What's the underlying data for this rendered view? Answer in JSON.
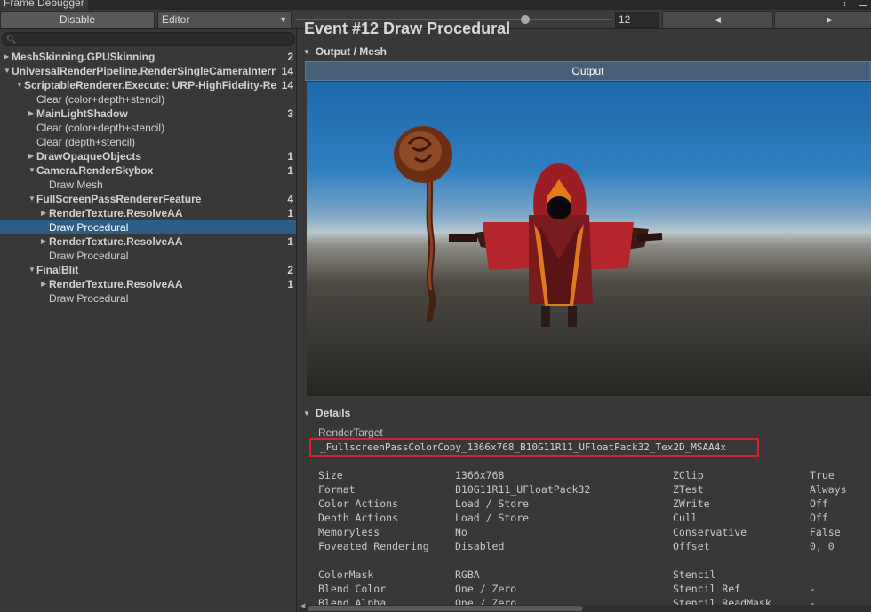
{
  "window": {
    "title": "Frame Debugger"
  },
  "toolbar": {
    "disable_label": "Disable",
    "target_label": "Editor",
    "frame_value": "12",
    "slider_fraction": 0.73,
    "prev_icon": "triangle-left-icon",
    "next_icon": "triangle-right-icon"
  },
  "tree": [
    {
      "label": "MeshSkinning.GPUSkinning",
      "count": "2",
      "depth": 0,
      "arrow": "right",
      "bold": true
    },
    {
      "label": "UniversalRenderPipeline.RenderSingleCameraInternal",
      "count": "14",
      "depth": 0,
      "arrow": "down",
      "bold": true
    },
    {
      "label": "ScriptableRenderer.Execute: URP-HighFidelity-Renderer",
      "count": "14",
      "depth": 1,
      "arrow": "down",
      "bold": true
    },
    {
      "label": "Clear (color+depth+stencil)",
      "count": "",
      "depth": 2,
      "arrow": "",
      "bold": false
    },
    {
      "label": "MainLightShadow",
      "count": "3",
      "depth": 2,
      "arrow": "right",
      "bold": true
    },
    {
      "label": "Clear (color+depth+stencil)",
      "count": "",
      "depth": 2,
      "arrow": "",
      "bold": false
    },
    {
      "label": "Clear (depth+stencil)",
      "count": "",
      "depth": 2,
      "arrow": "",
      "bold": false
    },
    {
      "label": "DrawOpaqueObjects",
      "count": "1",
      "depth": 2,
      "arrow": "right",
      "bold": true
    },
    {
      "label": "Camera.RenderSkybox",
      "count": "1",
      "depth": 2,
      "arrow": "down",
      "bold": true
    },
    {
      "label": "Draw Mesh",
      "count": "",
      "depth": 3,
      "arrow": "",
      "bold": false
    },
    {
      "label": "FullScreenPassRendererFeature",
      "count": "4",
      "depth": 2,
      "arrow": "down",
      "bold": true
    },
    {
      "label": "RenderTexture.ResolveAA",
      "count": "1",
      "depth": 3,
      "arrow": "right",
      "bold": true
    },
    {
      "label": "Draw Procedural",
      "count": "",
      "depth": 3,
      "arrow": "",
      "bold": false,
      "selected": true
    },
    {
      "label": "RenderTexture.ResolveAA",
      "count": "1",
      "depth": 3,
      "arrow": "right",
      "bold": true
    },
    {
      "label": "Draw Procedural",
      "count": "",
      "depth": 3,
      "arrow": "",
      "bold": false
    },
    {
      "label": "FinalBlit",
      "count": "2",
      "depth": 2,
      "arrow": "down",
      "bold": true
    },
    {
      "label": "RenderTexture.ResolveAA",
      "count": "1",
      "depth": 3,
      "arrow": "right",
      "bold": true
    },
    {
      "label": "Draw Procedural",
      "count": "",
      "depth": 3,
      "arrow": "",
      "bold": false
    }
  ],
  "main": {
    "event_title": "Event #12 Draw Procedural",
    "output_section": "Output / Mesh",
    "output_button": "Output",
    "details_section": "Details",
    "render_target_label": "RenderTarget",
    "render_target_value": "_FullscreenPassColorCopy_1366x768_B10G11R11_UFloatPack32_Tex2D_MSAA4x",
    "props_left": [
      {
        "k": "Size",
        "v": "1366x768"
      },
      {
        "k": "Format",
        "v": "B10G11R11_UFloatPack32"
      },
      {
        "k": "Color Actions",
        "v": "Load / Store"
      },
      {
        "k": "Depth Actions",
        "v": "Load / Store"
      },
      {
        "k": "Memoryless",
        "v": "No"
      },
      {
        "k": "Foveated Rendering",
        "v": "Disabled"
      }
    ],
    "props_right": [
      {
        "k": "ZClip",
        "v": "True"
      },
      {
        "k": "ZTest",
        "v": "Always"
      },
      {
        "k": "ZWrite",
        "v": "Off"
      },
      {
        "k": "Cull",
        "v": "Off"
      },
      {
        "k": "Conservative",
        "v": "False"
      },
      {
        "k": "Offset",
        "v": "0, 0"
      }
    ],
    "blend_left": [
      {
        "k": "ColorMask",
        "v": "RGBA"
      },
      {
        "k": "Blend Color",
        "v": "One / Zero"
      },
      {
        "k": "Blend Alpha",
        "v": "One / Zero"
      }
    ],
    "blend_right": [
      {
        "k": "Stencil",
        "v": ""
      },
      {
        "k": "Stencil Ref",
        "v": "-"
      },
      {
        "k": "Stencil ReadMask",
        "v": "-"
      }
    ]
  },
  "colors": {
    "selection": "#2c5d87",
    "highlight_border": "#d8222c",
    "output_button": "#46607a"
  }
}
